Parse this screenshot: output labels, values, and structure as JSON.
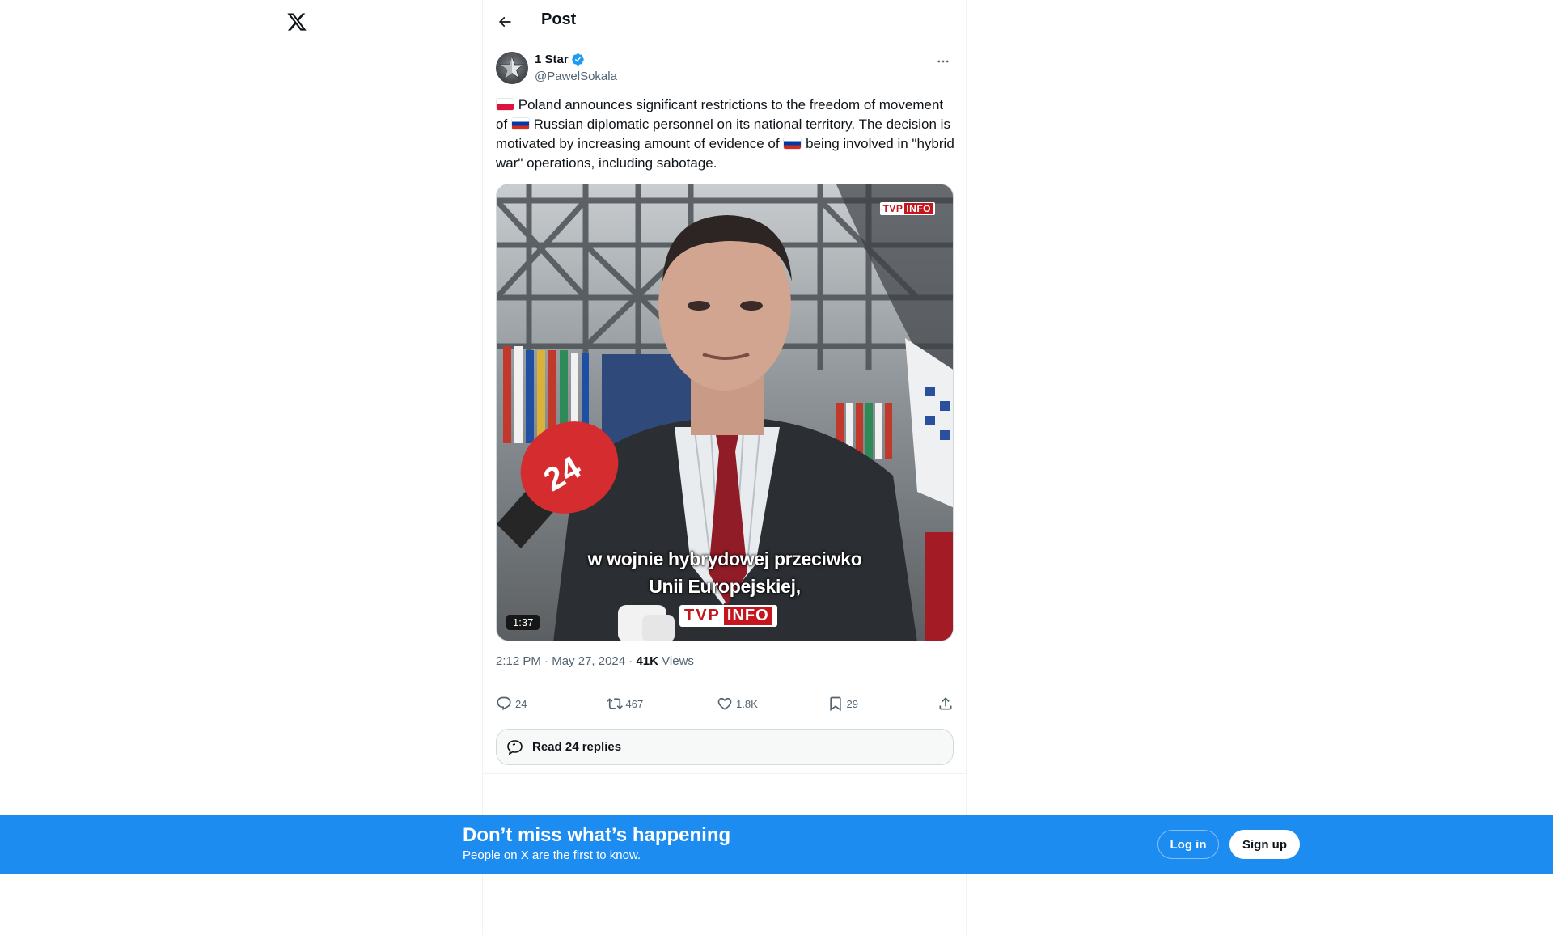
{
  "header": {
    "title": "Post"
  },
  "post": {
    "author_name": "1 Star",
    "author_handle": "@PawelSokala",
    "text_part1": "Poland announces significant restrictions to the freedom of movement of",
    "text_part2": "Russian diplomatic personnel on its national territory. The decision is motivated by increasing amount of evidence of",
    "text_part3": "being involved in \"hybrid war\" operations, including sabotage.",
    "media": {
      "duration": "1:37",
      "subtitle_line1": "w wojnie hybrydowej przeciwko",
      "subtitle_line2": "Unii Europejskiej,",
      "badge_a": "TVP",
      "badge_b": "INFO",
      "lower_a": "TVP",
      "lower_b": "INFO"
    },
    "time": "2:12 PM",
    "date": "May 27, 2024",
    "views_count": "41K",
    "views_label": "Views"
  },
  "actions": {
    "replies": "24",
    "reposts": "467",
    "likes": "1.8K",
    "bookmarks": "29"
  },
  "read_replies": {
    "label": "Read 24 replies"
  },
  "banner": {
    "title": "Don’t miss what’s happening",
    "subtitle": "People on X are the first to know.",
    "login_label": "Log in",
    "signup_label": "Sign up"
  },
  "colors": {
    "accent": "#1d9bf0",
    "banner_bg": "#1d8cf0",
    "text_primary": "#0f1419",
    "text_secondary": "#536471",
    "tvp_red": "#c4161c"
  },
  "icons": [
    "x-logo-icon",
    "back-arrow-icon",
    "verified-badge-icon",
    "more-icon",
    "reply-icon",
    "repost-icon",
    "like-icon",
    "bookmark-icon",
    "share-icon",
    "chat-bubbles-icon",
    "poland-flag-icon",
    "russia-flag-icon"
  ]
}
